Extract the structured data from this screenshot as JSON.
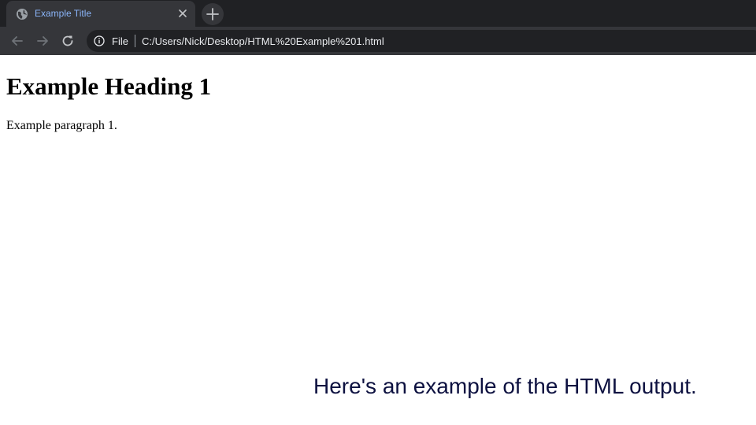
{
  "browser": {
    "tab": {
      "title": "Example Title",
      "favicon": "globe-icon",
      "close_icon": "close-icon"
    },
    "new_tab_icon": "plus-icon",
    "toolbar": {
      "back_icon": "arrow-left-icon",
      "forward_icon": "arrow-right-icon",
      "reload_icon": "reload-icon"
    },
    "omnibox": {
      "info_icon": "info-icon",
      "scheme_label": "File",
      "url": "C:/Users/Nick/Desktop/HTML%20Example%201.html"
    }
  },
  "page": {
    "heading": "Example Heading 1",
    "paragraph": "Example paragraph 1."
  },
  "caption": "Here's an example of the HTML output.",
  "colors": {
    "chrome_bg": "#35363a",
    "tab_strip_bg": "#202124",
    "tab_title": "#8ab4f8",
    "caption": "#0d1140"
  }
}
